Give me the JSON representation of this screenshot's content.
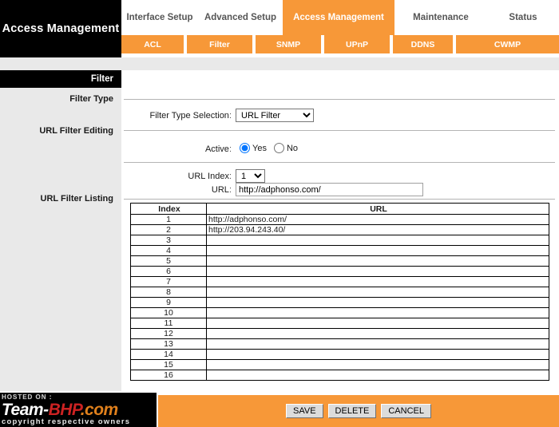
{
  "brand": {
    "title": "Access Management"
  },
  "main_tabs": [
    {
      "label": "Interface Setup",
      "active": false
    },
    {
      "label": "Advanced Setup",
      "active": false
    },
    {
      "label": "Access Management",
      "active": true
    },
    {
      "label": "Maintenance",
      "active": false
    },
    {
      "label": "Status",
      "active": false
    }
  ],
  "sub_tabs": [
    {
      "label": "ACL"
    },
    {
      "label": "Filter"
    },
    {
      "label": "SNMP"
    },
    {
      "label": "UPnP"
    },
    {
      "label": "DDNS"
    },
    {
      "label": "CWMP"
    }
  ],
  "section": {
    "title": "Filter"
  },
  "sidebar": {
    "items": [
      {
        "label": "Filter Type"
      },
      {
        "label": "URL Filter Editing"
      },
      {
        "label": "URL Filter Listing"
      }
    ]
  },
  "form": {
    "filter_type_label": "Filter Type Selection",
    "filter_type_value": "URL Filter",
    "filter_type_options": [
      "URL Filter"
    ],
    "active_label": "Active",
    "active_value": "Yes",
    "active_yes_label": "Yes",
    "active_no_label": "No",
    "url_index_label": "URL Index",
    "url_index_value": "1",
    "url_index_options": [
      "1"
    ],
    "url_label": "URL",
    "url_value": "http://adphonso.com/",
    "colon": ":"
  },
  "listing": {
    "headers": [
      "Index",
      "URL"
    ],
    "rows": [
      {
        "index": "1",
        "url": "http://adphonso.com/"
      },
      {
        "index": "2",
        "url": "http://203.94.243.40/"
      },
      {
        "index": "3",
        "url": ""
      },
      {
        "index": "4",
        "url": ""
      },
      {
        "index": "5",
        "url": ""
      },
      {
        "index": "6",
        "url": ""
      },
      {
        "index": "7",
        "url": ""
      },
      {
        "index": "8",
        "url": ""
      },
      {
        "index": "9",
        "url": ""
      },
      {
        "index": "10",
        "url": ""
      },
      {
        "index": "11",
        "url": ""
      },
      {
        "index": "12",
        "url": ""
      },
      {
        "index": "13",
        "url": ""
      },
      {
        "index": "14",
        "url": ""
      },
      {
        "index": "15",
        "url": ""
      },
      {
        "index": "16",
        "url": ""
      }
    ]
  },
  "footer": {
    "save_label": "SAVE",
    "delete_label": "DELETE",
    "cancel_label": "CANCEL"
  },
  "watermark": {
    "hosted_label": "HOSTED ON :",
    "name_part1": "Team-",
    "name_part2": "BHP",
    "name_part3": ".com",
    "copyright": "copyright respective owners"
  },
  "colors": {
    "accent_orange": "#F79838",
    "sidebar_gray": "#e9e9e9",
    "header_black": "#000000"
  }
}
